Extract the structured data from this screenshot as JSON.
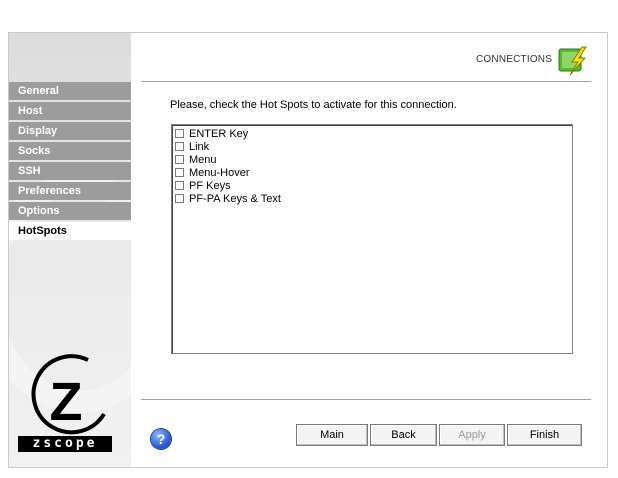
{
  "header": {
    "title": "CONNECTIONS",
    "icon": "connections-bolt-icon"
  },
  "sidebar": {
    "items": [
      {
        "label": "General",
        "active": false
      },
      {
        "label": "Host",
        "active": false
      },
      {
        "label": "Display",
        "active": false
      },
      {
        "label": "Socks",
        "active": false
      },
      {
        "label": "SSH",
        "active": false
      },
      {
        "label": "Preferences",
        "active": false
      },
      {
        "label": "Options",
        "active": false
      },
      {
        "label": "HotSpots",
        "active": true
      }
    ],
    "logo_letter": "Z",
    "logo_text": "zscope"
  },
  "main": {
    "instruction": "Please, check the Hot Spots to activate for this connection.",
    "hotspots": [
      {
        "label": "ENTER Key",
        "checked": false
      },
      {
        "label": "Link",
        "checked": false
      },
      {
        "label": "Menu",
        "checked": false
      },
      {
        "label": "Menu-Hover",
        "checked": false
      },
      {
        "label": "PF Keys",
        "checked": false
      },
      {
        "label": "PF-PA Keys & Text",
        "checked": false
      }
    ]
  },
  "footer": {
    "help_label": "?",
    "buttons": {
      "main": "Main",
      "back": "Back",
      "apply": "Apply",
      "finish": "Finish"
    }
  },
  "colors": {
    "nav_bg": "#9c9c9c",
    "help_blue": "#2f5fd0",
    "icon_green": "#59b82e",
    "icon_bolt": "#f2e11b"
  }
}
